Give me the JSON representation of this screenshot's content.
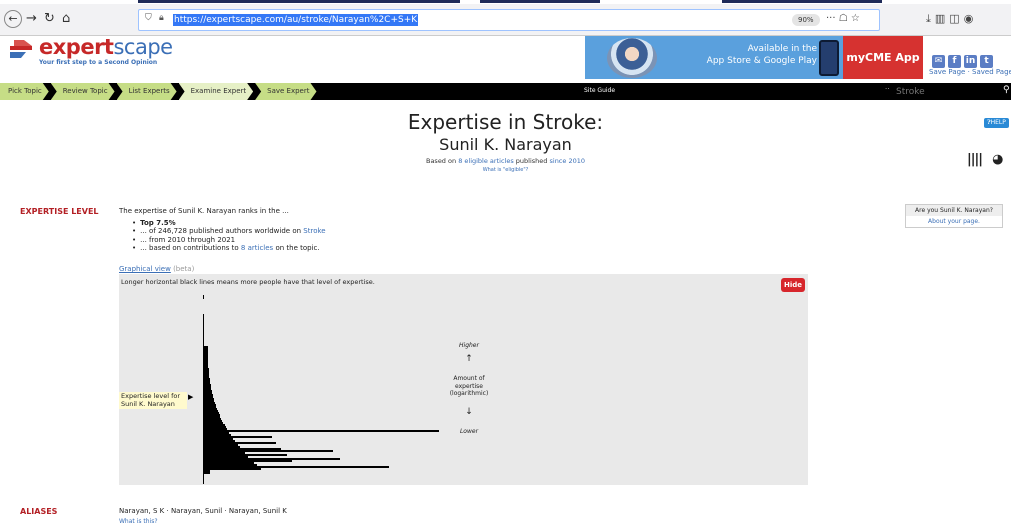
{
  "browser": {
    "url": "https://expertscape.com/au/stroke/Narayan%2C+S+K",
    "zoom": "90%",
    "menu_dots": "···"
  },
  "site": {
    "logo_primary": "expert",
    "logo_secondary": "scape",
    "tagline": "Your first step to a Second Opinion"
  },
  "ad": {
    "line1": "Available in the",
    "line2": "App Store & Google Play",
    "cta": "myCME App"
  },
  "header_links": {
    "save_page": "Save Page",
    "separator": " · ",
    "saved_page": "Saved Page"
  },
  "nav": {
    "crumbs": [
      "Pick Topic",
      "Review Topic",
      "List Experts",
      "Examine Expert",
      "Save Expert"
    ],
    "site_guide": "Site Guide",
    "search_placeholder": "Stroke",
    "dots": "··"
  },
  "page": {
    "title": "Expertise in Stroke:",
    "name": "Sunil K. Narayan",
    "based_prefix": "Based on",
    "based_link": "8 eligible articles",
    "based_mid": "published",
    "based_since": "since 2010",
    "eligible_q": "What is \"eligible\"?",
    "help": "HELP"
  },
  "expertise": {
    "label": "EXPERTISE LEVEL",
    "intro": "The expertise of Sunil K. Narayan ranks in the ...",
    "top": "Top 7.5%",
    "authors_prefix": "... of 246,728 published authors worldwide on",
    "authors_link": "Stroke",
    "range": "... from 2010 through 2021",
    "contrib_prefix": "... based on contributions to",
    "contrib_link": "8 articles",
    "contrib_suffix": "on the topic."
  },
  "you_box": {
    "question": "Are you Sunil K. Narayan?",
    "about": "About your page."
  },
  "graph": {
    "view_label": "Graphical view",
    "beta": "(beta)",
    "description": "Longer horizontal black lines means more people have that level of expertise.",
    "hide": "Hide",
    "marker_line1": "Expertise level for",
    "marker_line2": "Sunil K. Narayan",
    "higher": "Higher",
    "up_arrow": "↑",
    "amount1": "Amount of",
    "amount2": "expertise",
    "amount3": "(logarithmic)",
    "down_arrow": "↓",
    "lower": "Lower"
  },
  "aliases": {
    "label": "ALIASES",
    "list": "Narayan, S K  ·  Narayan, Sunil  ·  Narayan, Sunil K",
    "what": "What is this?"
  }
}
